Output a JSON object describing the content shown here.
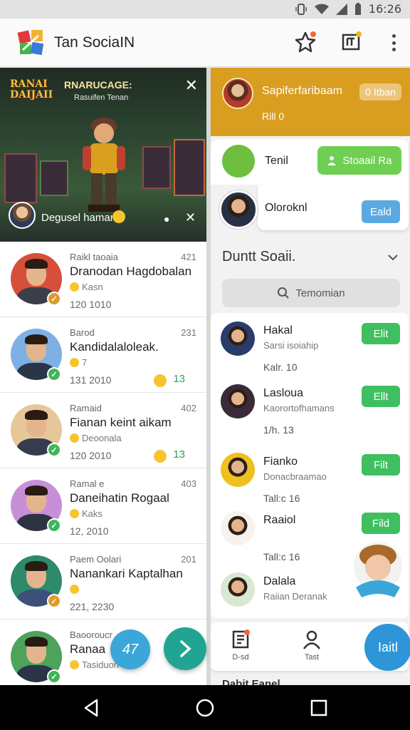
{
  "status_bar": {
    "time": "16:26"
  },
  "app_bar": {
    "title": "Tan SociaIN",
    "icons": [
      "app-logo-icon",
      "star-notification-icon",
      "book-notification-icon",
      "more-vert-icon"
    ]
  },
  "game_card": {
    "title": "RANAI DAIJAII",
    "headline": "RNARUCAGE:",
    "subtitle": "Rasuifen Tenan",
    "caption": "Degusel hamam",
    "close_icon": "close-icon"
  },
  "feed": [
    {
      "meta": "Raikl taoaia",
      "time": "421",
      "name": "Dranodan Hagdobalan",
      "sub": "Kasn",
      "date": "120 1010",
      "count": "",
      "badge_color": "#e09a2c",
      "avatar_bg": "#d74f3a",
      "shirt": "#3a3f4a"
    },
    {
      "meta": "Barod",
      "time": "231",
      "name": "Kandidalaloleak.",
      "sub": "7",
      "date": "131 2010",
      "count": "13",
      "badge_color": "#3fb55a",
      "avatar_bg": "#7fb0e4",
      "shirt": "#2b3548"
    },
    {
      "meta": "Ramaid",
      "time": "402",
      "name": "Fianan keint aikam",
      "sub": "Deoonala",
      "date": "120 2010",
      "count": "13",
      "badge_color": "#3fb55a",
      "avatar_bg": "#e6c79a",
      "shirt": "#343c4e"
    },
    {
      "meta": "Ramal e",
      "time": "403",
      "name": "Daneihatin Rogaal",
      "sub": "Kaks",
      "date": "12, 2010",
      "count": "",
      "badge_color": "#3fb55a",
      "avatar_bg": "#c78fd8",
      "shirt": "#2e3342"
    },
    {
      "meta": "Paem Oolari",
      "time": "201",
      "name": "Nanankari Kaptalhan",
      "sub": "",
      "date": "221, 2230",
      "count": "",
      "badge_color": "#e09a2c",
      "avatar_bg": "#2e8a6a",
      "shirt": "#3d4f7a"
    },
    {
      "meta": "Baooroucr",
      "time": "",
      "name": "Ranaa",
      "sub": "Tasiduon",
      "date": "",
      "count": "",
      "badge_color": "#3fb55a",
      "avatar_bg": "#4ea35a",
      "shirt": "#2b3548"
    }
  ],
  "fab": {
    "count_label": "47"
  },
  "profile": {
    "name": "Sapiferfaribaam",
    "pill": "0 Itban",
    "sub": "Rill 0"
  },
  "suggestions": [
    {
      "label": "Tenil",
      "button": "Stoaail Ra"
    },
    {
      "label": "Oloroknl",
      "button": "Eald"
    }
  ],
  "section": {
    "title": "Duntt Soaii.",
    "search_placeholder": "Temomian"
  },
  "contacts": [
    {
      "name": "Hakal",
      "sub": "Sarsi isoiahip",
      "time": "Kalr. 10",
      "button": "Elit",
      "avatar_bg": "#2a3c6a"
    },
    {
      "name": "Lasloua",
      "sub": "Kaorortofhamans",
      "time": "1/h. 13",
      "button": "Ellt",
      "avatar_bg": "#3a2a3a"
    },
    {
      "name": "Fianko",
      "sub": "Donacbraamao",
      "time": "Tall:c 16",
      "button": "Filt",
      "avatar_bg": "#f0c020"
    },
    {
      "name": "Raaiol",
      "sub": "",
      "time": "Tall:c 16",
      "button": "Fild",
      "avatar_bg": "#f6f2ee"
    },
    {
      "name": "Dalala",
      "sub": "Raiian Deranak",
      "time": "",
      "button": "",
      "avatar_bg": "#d9e8d0"
    }
  ],
  "bottom_nav": {
    "items": [
      {
        "label": "D-sd",
        "icon": "document-icon"
      },
      {
        "label": "Tast",
        "icon": "person-icon"
      }
    ],
    "fab_label": "Iaitl"
  },
  "below_nav_text": "Dabit Eanel",
  "colors": {
    "accent_orange": "#d99d1f",
    "accent_green": "#3fbf60",
    "accent_blue": "#2d95d8",
    "teal": "#21a592"
  }
}
